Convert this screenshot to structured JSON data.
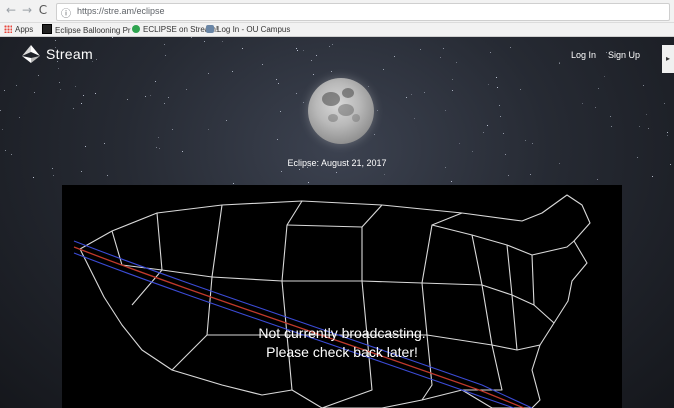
{
  "browser": {
    "url": "https://stre.am/eclipse",
    "bookmarks": [
      "Apps",
      "Eclipse Ballooning Pr",
      "ECLIPSE on Stream!",
      "Log In - OU Campus"
    ]
  },
  "site": {
    "logo_text": "Stream",
    "nav": {
      "login": "Log In",
      "signup": "Sign Up"
    }
  },
  "main": {
    "title": "Eclipse: August 21, 2017",
    "message_line1": "Not currently broadcasting.",
    "message_line2": "Please check back later!"
  },
  "colors": {
    "background": "#262a33",
    "video_bg": "#000000",
    "path_red": "#c0392b",
    "path_blue": "#3b4bd6"
  }
}
